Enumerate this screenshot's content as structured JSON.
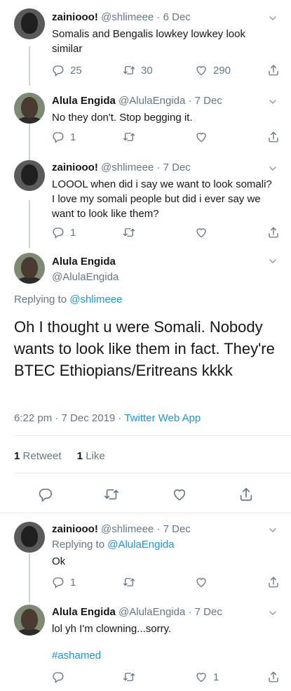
{
  "tweets": [
    {
      "name": "zainiooo!",
      "handle": "@shlimeee",
      "date": "6 Dec",
      "text": "Somalis and Bengalis lowkey lowkey look similar",
      "replies": "25",
      "retweets": "30",
      "likes": "290"
    },
    {
      "name": "Alula Engida",
      "handle": "@AlulaEngida",
      "date": "7 Dec",
      "text": "No they don't. Stop begging it.",
      "replies": "1",
      "retweets": "",
      "likes": ""
    },
    {
      "name": "zainiooo!",
      "handle": "@shlimeee",
      "date": "7 Dec",
      "text": "LOOOL when did i say we want to look somali? I love my somali people but did i ever say we want to look like them?",
      "replies": "1",
      "retweets": "",
      "likes": ""
    }
  ],
  "focus": {
    "name": "Alula Engida",
    "handle": "@AlulaEngida",
    "replying_prefix": "Replying to",
    "replying_to": "@shlimeee",
    "text": "Oh I thought u were Somali. Nobody wants to look like them in fact. They're BTEC Ethiopians/Eritreans kkkk",
    "time": "6:22 pm · 7 Dec 2019 ·",
    "source": "Twitter Web App",
    "retweets_count": "1",
    "retweets_label": "Retweet",
    "likes_count": "1",
    "likes_label": "Like"
  },
  "replies": [
    {
      "name": "zainiooo!",
      "handle": "@shlimeee",
      "date": "7 Dec",
      "replying_prefix": "Replying to",
      "replying_to": "@AlulaEngida",
      "text": "Ok",
      "replies": "1",
      "retweets": "",
      "likes": ""
    },
    {
      "name": "Alula Engida",
      "handle": "@AlulaEngida",
      "date": "7 Dec",
      "text": "lol yh I'm clowning...sorry.",
      "hashtag": "#ashamed",
      "replies": "",
      "retweets": "",
      "likes": "1"
    }
  ],
  "separator": "·",
  "colors": {
    "link": "#1b95e0",
    "muted": "#657786",
    "text": "#14171a",
    "line": "#ccd6dd"
  },
  "icons": [
    "reply-icon",
    "retweet-icon",
    "like-icon",
    "share-icon",
    "chevron-down-icon"
  ]
}
